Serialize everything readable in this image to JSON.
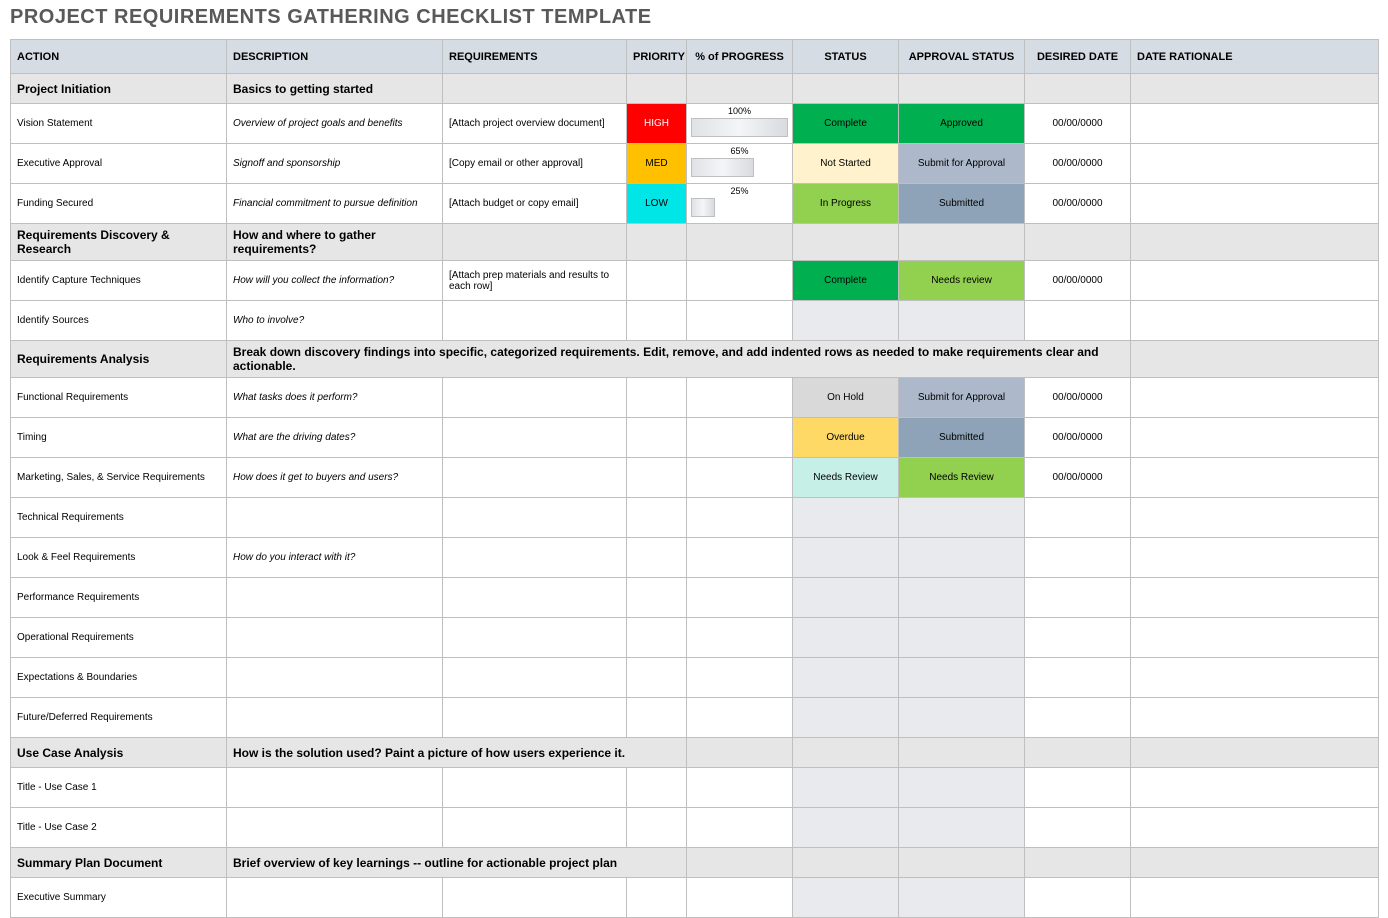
{
  "title": "PROJECT REQUIREMENTS GATHERING CHECKLIST TEMPLATE",
  "columns": {
    "action": "ACTION",
    "description": "DESCRIPTION",
    "requirements": "REQUIREMENTS",
    "priority": "PRIORITY",
    "progress": "% of PROGRESS",
    "status": "STATUS",
    "approval": "APPROVAL STATUS",
    "date": "DESIRED DATE",
    "rationale": "DATE RATIONALE"
  },
  "sections": {
    "project_initiation": {
      "label": "Project Initiation",
      "desc": "Basics to getting started"
    },
    "req_discovery": {
      "label": "Requirements Discovery & Research",
      "desc": "How and where to gather requirements?"
    },
    "req_analysis": {
      "label": "Requirements Analysis",
      "desc": "Break down discovery findings into specific, categorized requirements. Edit, remove, and add indented rows as needed to make requirements clear and actionable."
    },
    "use_case": {
      "label": "Use Case Analysis",
      "desc": "How is the solution used? Paint a picture of how users experience it."
    },
    "summary": {
      "label": "Summary Plan Document",
      "desc": "Brief overview of key learnings -- outline for actionable project plan"
    }
  },
  "rows": {
    "vision": {
      "action": "Vision Statement",
      "desc": "Overview of project goals and benefits",
      "req": "[Attach project overview document]",
      "priority": "HIGH",
      "progress": "100%",
      "status": "Complete",
      "approval": "Approved",
      "date": "00/00/0000"
    },
    "exec_approval": {
      "action": "Executive Approval",
      "desc": "Signoff and sponsorship",
      "req": "[Copy email or other approval]",
      "priority": "MED",
      "progress": "65%",
      "status": "Not Started",
      "approval": "Submit for Approval",
      "date": "00/00/0000"
    },
    "funding": {
      "action": "Funding Secured",
      "desc": "Financial commitment to pursue definition",
      "req": "[Attach budget or copy email]",
      "priority": "LOW",
      "progress": "25%",
      "status": "In Progress",
      "approval": "Submitted",
      "date": "00/00/0000"
    },
    "capture": {
      "action": "Identify Capture Techniques",
      "desc": "How will you collect the information?",
      "req": "[Attach prep materials and results to each row]",
      "status": "Complete",
      "approval": "Needs review",
      "date": "00/00/0000"
    },
    "sources": {
      "action": "Identify Sources",
      "desc": "Who to involve?"
    },
    "functional": {
      "action": "Functional Requirements",
      "desc": "What tasks does it perform?",
      "status": "On Hold",
      "approval": "Submit for Approval",
      "date": "00/00/0000"
    },
    "timing": {
      "action": "Timing",
      "desc": "What are the driving dates?",
      "status": "Overdue",
      "approval": "Submitted",
      "date": "00/00/0000"
    },
    "marketing": {
      "action": "Marketing, Sales, & Service Requirements",
      "desc": "How does it get to buyers and users?",
      "status": "Needs Review",
      "approval": "Needs Review",
      "date": "00/00/0000"
    },
    "technical": {
      "action": "Technical Requirements"
    },
    "lookfeel": {
      "action": "Look & Feel Requirements",
      "desc": "How do you interact with it?"
    },
    "performance": {
      "action": "Performance Requirements"
    },
    "operational": {
      "action": "Operational Requirements"
    },
    "expectations": {
      "action": "Expectations & Boundaries"
    },
    "future": {
      "action": "Future/Deferred Requirements"
    },
    "uc1": {
      "action": "Title - Use Case 1"
    },
    "uc2": {
      "action": "Title - Use Case 2"
    },
    "exec_summary": {
      "action": "Executive Summary"
    }
  }
}
